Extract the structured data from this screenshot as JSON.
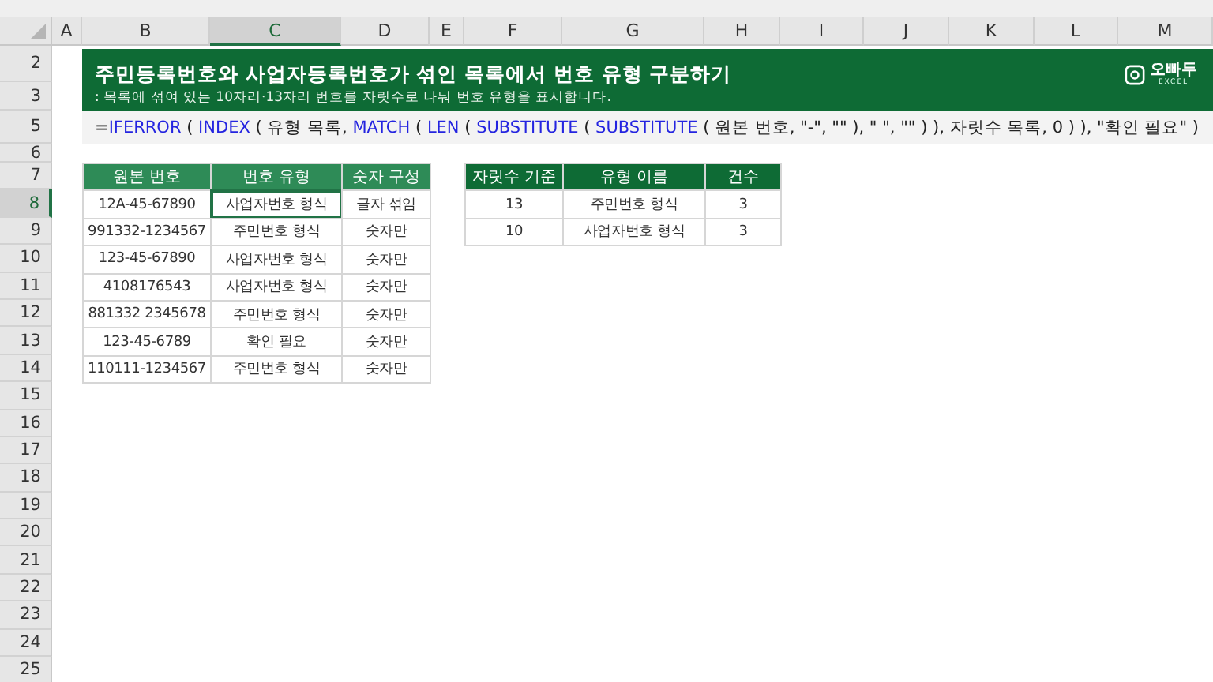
{
  "column_headers": [
    {
      "label": "A",
      "selected": false
    },
    {
      "label": "B",
      "selected": false
    },
    {
      "label": "C",
      "selected": true
    },
    {
      "label": "D",
      "selected": false
    },
    {
      "label": "E",
      "selected": false
    },
    {
      "label": "F",
      "selected": false
    },
    {
      "label": "G",
      "selected": false
    },
    {
      "label": "H",
      "selected": false
    },
    {
      "label": "I",
      "selected": false
    },
    {
      "label": "J",
      "selected": false
    },
    {
      "label": "K",
      "selected": false
    },
    {
      "label": "L",
      "selected": false
    },
    {
      "label": "M",
      "selected": false
    }
  ],
  "row_headers": [
    {
      "label": "2",
      "selected": false
    },
    {
      "label": "3",
      "selected": false
    },
    {
      "label": "5",
      "selected": false
    },
    {
      "label": "6",
      "selected": false
    },
    {
      "label": "7",
      "selected": false
    },
    {
      "label": "8",
      "selected": true
    },
    {
      "label": "9",
      "selected": false
    },
    {
      "label": "10",
      "selected": false
    },
    {
      "label": "11",
      "selected": false
    },
    {
      "label": "12",
      "selected": false
    },
    {
      "label": "13",
      "selected": false
    },
    {
      "label": "14",
      "selected": false
    },
    {
      "label": "15",
      "selected": false
    },
    {
      "label": "16",
      "selected": false
    },
    {
      "label": "17",
      "selected": false
    },
    {
      "label": "18",
      "selected": false
    },
    {
      "label": "19",
      "selected": false
    },
    {
      "label": "20",
      "selected": false
    },
    {
      "label": "21",
      "selected": false
    },
    {
      "label": "22",
      "selected": false
    },
    {
      "label": "23",
      "selected": false
    },
    {
      "label": "24",
      "selected": false
    },
    {
      "label": "25",
      "selected": false
    }
  ],
  "banner": {
    "title": "주민등록번호와 사업자등록번호가 섞인 목록에서 번호 유형 구분하기",
    "subtitle": ": 목록에 섞여 있는 10자리·13자리 번호를 자릿수로 나눠 번호 유형을 표시합니다.",
    "logo": {
      "name": "오빠두",
      "tagline": "EXCEL"
    }
  },
  "formula": [
    {
      "kind": "plain",
      "text": "="
    },
    {
      "kind": "function",
      "text": "IFERROR"
    },
    {
      "kind": "plain",
      "text": " ( "
    },
    {
      "kind": "function",
      "text": "INDEX"
    },
    {
      "kind": "plain",
      "text": " ( 유형 목록, "
    },
    {
      "kind": "function",
      "text": "MATCH"
    },
    {
      "kind": "plain",
      "text": " ( "
    },
    {
      "kind": "function",
      "text": "LEN"
    },
    {
      "kind": "plain",
      "text": " ( "
    },
    {
      "kind": "function",
      "text": "SUBSTITUTE"
    },
    {
      "kind": "plain",
      "text": " ( "
    },
    {
      "kind": "function",
      "text": "SUBSTITUTE"
    },
    {
      "kind": "plain",
      "text": " ( 원본 번호, \"-\", \"\" ), \" \", \"\" ) ), 자릿수 목록, 0 ) ), \"확인 필요\" )"
    }
  ],
  "number_table": {
    "columns": [
      "원본 번호",
      "번호 유형",
      "숫자 구성"
    ],
    "rows": [
      {
        "cells": [
          {
            "text": "12A-45-67890",
            "selected": false
          },
          {
            "text": "사업자번호 형식",
            "selected": true
          },
          {
            "text": "글자 섞임",
            "selected": false
          }
        ]
      },
      {
        "cells": [
          {
            "text": "991332-1234567",
            "selected": false
          },
          {
            "text": "주민번호 형식",
            "selected": false
          },
          {
            "text": "숫자만",
            "selected": false
          }
        ]
      },
      {
        "cells": [
          {
            "text": "123-45-67890",
            "selected": false
          },
          {
            "text": "사업자번호 형식",
            "selected": false
          },
          {
            "text": "숫자만",
            "selected": false
          }
        ]
      },
      {
        "cells": [
          {
            "text": "4108176543",
            "selected": false
          },
          {
            "text": "사업자번호 형식",
            "selected": false
          },
          {
            "text": "숫자만",
            "selected": false
          }
        ]
      },
      {
        "cells": [
          {
            "text": "881332 2345678",
            "selected": false
          },
          {
            "text": "주민번호 형식",
            "selected": false
          },
          {
            "text": "숫자만",
            "selected": false
          }
        ]
      },
      {
        "cells": [
          {
            "text": "123-45-6789",
            "selected": false
          },
          {
            "text": "확인 필요",
            "selected": false
          },
          {
            "text": "숫자만",
            "selected": false
          }
        ]
      },
      {
        "cells": [
          {
            "text": "110111-1234567",
            "selected": false
          },
          {
            "text": "주민번호 형식",
            "selected": false
          },
          {
            "text": "숫자만",
            "selected": false
          }
        ]
      }
    ]
  },
  "type_table": {
    "columns": [
      "자릿수 기준",
      "유형 이름",
      "건수"
    ],
    "rows": [
      [
        "13",
        "주민번호 형식",
        "3"
      ],
      [
        "10",
        "사업자번호 형식",
        "3"
      ]
    ]
  }
}
